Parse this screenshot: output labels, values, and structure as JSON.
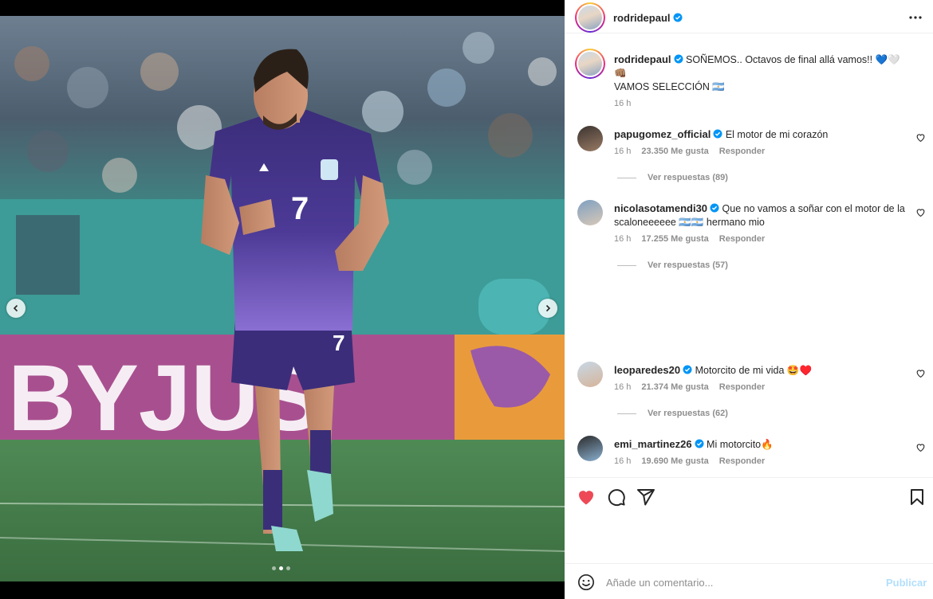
{
  "post": {
    "author": "rodridepaul",
    "verified": true,
    "caption_line1": "SOÑEMOS.. Octavos de final allá vamos!! 💙🤍",
    "caption_line2": "👊🏽",
    "caption_line3": "VAMOS SELECCIÓN 🇦🇷",
    "time": "16 h",
    "carousel": {
      "total_slides": 3,
      "active_slide": 2
    }
  },
  "comments": [
    {
      "user": "papugomez_official",
      "text": "El motor de mi corazón",
      "time": "16 h",
      "likes": "23.350 Me gusta",
      "reply": "Responder",
      "view_replies": "Ver respuestas (89)"
    },
    {
      "user": "nicolasotamendi30",
      "text": "Que no vamos a soñar con el motor de la scaloneeeeee 🇦🇷🇦🇷 hermano mio",
      "time": "16 h",
      "likes": "17.255 Me gusta",
      "reply": "Responder",
      "view_replies": "Ver respuestas (57)"
    },
    {
      "user": "leoparedes20",
      "text": "Motorcito de mi vida 🤩♥️",
      "time": "16 h",
      "likes": "21.374 Me gusta",
      "reply": "Responder",
      "view_replies": "Ver respuestas (62)"
    },
    {
      "user": "emi_martinez26",
      "text": "Mi motorcito🔥",
      "time": "16 h",
      "likes": "19.690 Me gusta",
      "reply": "Responder",
      "view_replies": ""
    }
  ],
  "photo": {
    "jersey_number": "7",
    "banner_text": "BYJUS"
  },
  "composer": {
    "placeholder": "Añade un comentario...",
    "publish_label": "Publicar"
  },
  "actions": {
    "liked": true
  },
  "colors": {
    "like_red": "#ed4956",
    "verified_blue": "#0095f6",
    "link_blue_disabled": "#b2dffc",
    "meta_gray": "#8e8e8e"
  },
  "icons": [
    "more-icon",
    "heart-icon",
    "comment-icon",
    "share-icon",
    "bookmark-icon",
    "emoji-icon",
    "chevron-left-icon",
    "chevron-right-icon",
    "verified-icon"
  ]
}
